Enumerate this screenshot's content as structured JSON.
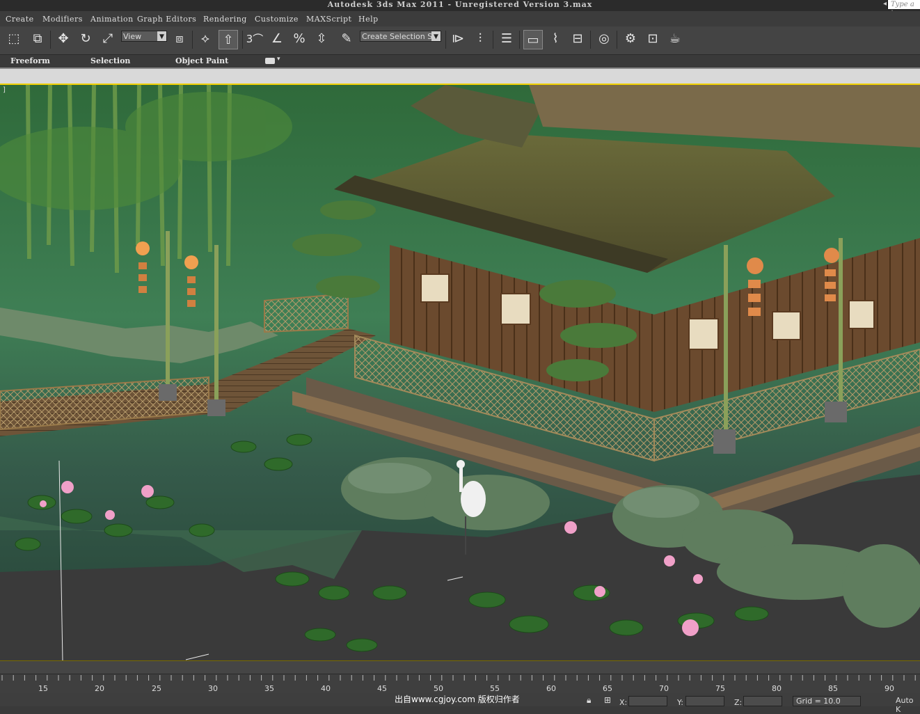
{
  "window": {
    "title": "Autodesk 3ds Max  2011   - Unregistered Version     3.max",
    "search_placeholder": "Type a k"
  },
  "menu": [
    "Create",
    "Modifiers",
    "Animation",
    "Graph Editors",
    "Rendering",
    "Customize",
    "MAXScript",
    "Help"
  ],
  "toolbar": {
    "reference_coord": "View",
    "selection_set_placeholder": "Create Selection Set",
    "snap_label": "3",
    "icons": [
      "rect-select-icon",
      "window-crossing-icon",
      "move-icon",
      "rotate-icon",
      "scale-icon",
      "pivot-icon",
      "manipulate-icon",
      "snap-toggle-icon",
      "angle-snap-icon",
      "percent-snap-icon",
      "spinner-snap-icon",
      "named-selection-icon",
      "mirror-icon",
      "align-icon",
      "layer-manager-icon",
      "graphite-toggle-icon",
      "curve-editor-icon",
      "schematic-view-icon",
      "material-editor-icon",
      "render-setup-icon",
      "rendered-frame-icon",
      "render-production-icon"
    ]
  },
  "ribbon": {
    "tabs": [
      "Freeform",
      "Selection",
      "Object Paint"
    ]
  },
  "viewport": {
    "label": "]",
    "description_scene": "Chinese pavilion by pond"
  },
  "timeline": {
    "ticks": [
      "15",
      "20",
      "25",
      "30",
      "35",
      "40",
      "45",
      "50",
      "55",
      "60",
      "65",
      "70",
      "75",
      "80",
      "85",
      "90"
    ]
  },
  "statusbar": {
    "watermark": "出自www.cgjoy.com 版权归作者",
    "x_label": "X:",
    "y_label": "Y:",
    "z_label": "Z:",
    "grid": "Grid = 10.0",
    "auto_key": "Auto K"
  },
  "colors": {
    "viewport_border": "#f0d000",
    "ui_dark": "#3c3c3c"
  }
}
